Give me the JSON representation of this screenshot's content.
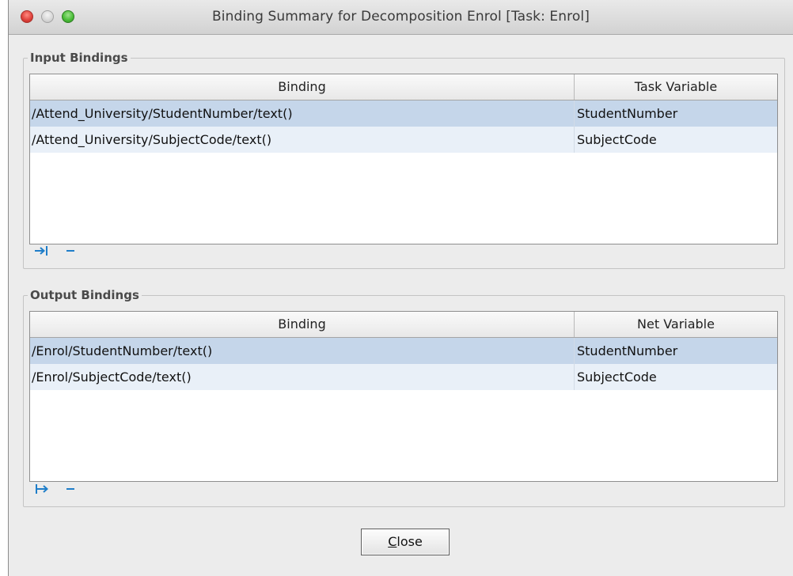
{
  "window": {
    "title": "Binding Summary for Decomposition Enrol [Task: Enrol]"
  },
  "input_bindings": {
    "title": "Input Bindings",
    "columns": [
      "Binding",
      "Task Variable"
    ],
    "rows": [
      {
        "binding": "/Attend_University/StudentNumber/text()",
        "variable": "StudentNumber",
        "selected": true
      },
      {
        "binding": "/Attend_University/SubjectCode/text()",
        "variable": "SubjectCode",
        "selected": false
      }
    ],
    "toolbar": [
      "add-binding-icon",
      "remove-binding-icon"
    ]
  },
  "output_bindings": {
    "title": "Output Bindings",
    "columns": [
      "Binding",
      "Net Variable"
    ],
    "rows": [
      {
        "binding": "/Enrol/StudentNumber/text()",
        "variable": "StudentNumber",
        "selected": true
      },
      {
        "binding": "/Enrol/SubjectCode/text()",
        "variable": "SubjectCode",
        "selected": false
      }
    ],
    "toolbar": [
      "add-binding-icon",
      "remove-binding-icon"
    ]
  },
  "buttons": {
    "close_mnemonic": "C",
    "close_rest": "lose"
  },
  "colors": {
    "selected_row": "#c5d6ea",
    "alt_row": "#e9f0f8",
    "icon_accent": "#1f7ec9"
  }
}
